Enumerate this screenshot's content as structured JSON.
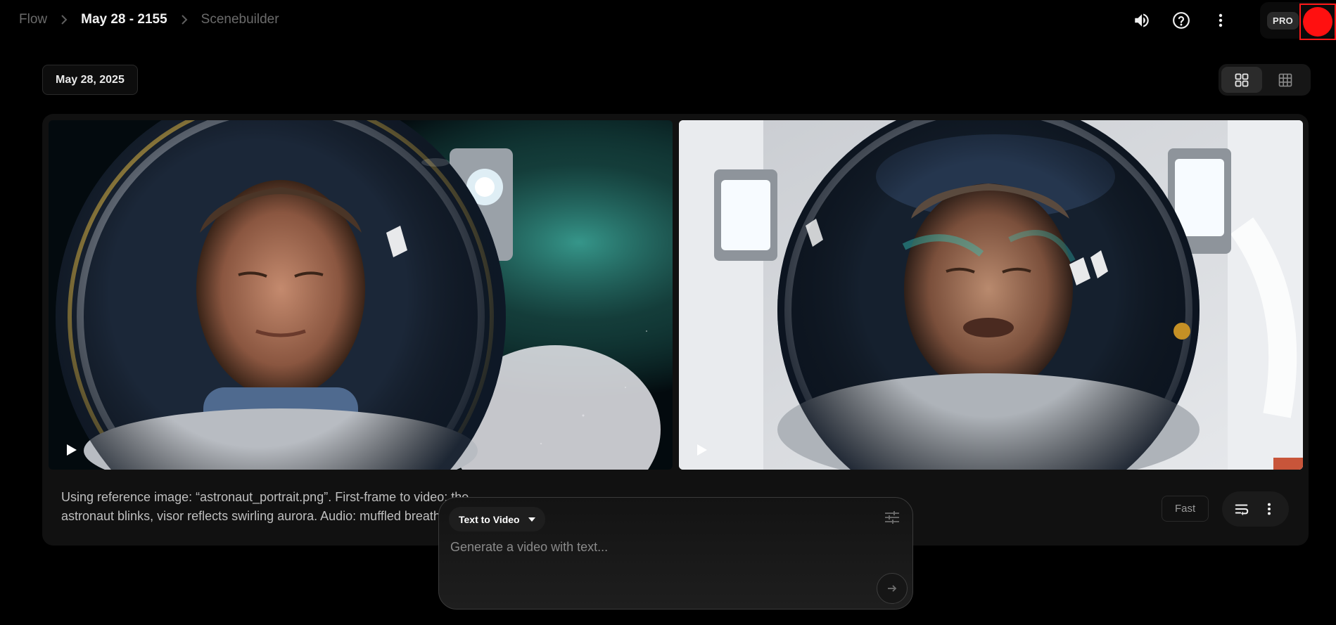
{
  "breadcrumb": {
    "root": "Flow",
    "project": "May 28 - 2155",
    "page": "Scenebuilder"
  },
  "header": {
    "icons": [
      "volume-icon",
      "help-icon",
      "more-vert-icon"
    ],
    "plan_badge": "PRO"
  },
  "date_chip": "May 28, 2025",
  "view_toggle": {
    "options": [
      "grid-large-icon",
      "grid-small-icon"
    ],
    "selected": "grid-large-icon"
  },
  "result_card": {
    "prompt": "Using reference image: “astronaut_portrait.png”. First-frame to video: the astronaut blinks, visor reflects swirling aurora. Audio: muffled breathing",
    "speed_label": "Fast",
    "actions": [
      "reuse-prompt-icon",
      "more-vert-icon"
    ],
    "thumbnails": [
      "video-thumbnail-1",
      "video-thumbnail-2"
    ]
  },
  "composer": {
    "mode": "Text to Video",
    "placeholder": "Generate a video with text..."
  },
  "colors": {
    "background": "#000000",
    "card": "#111111",
    "avatar": "#ff1010",
    "avatar_highlight": "#ff1a1a"
  }
}
